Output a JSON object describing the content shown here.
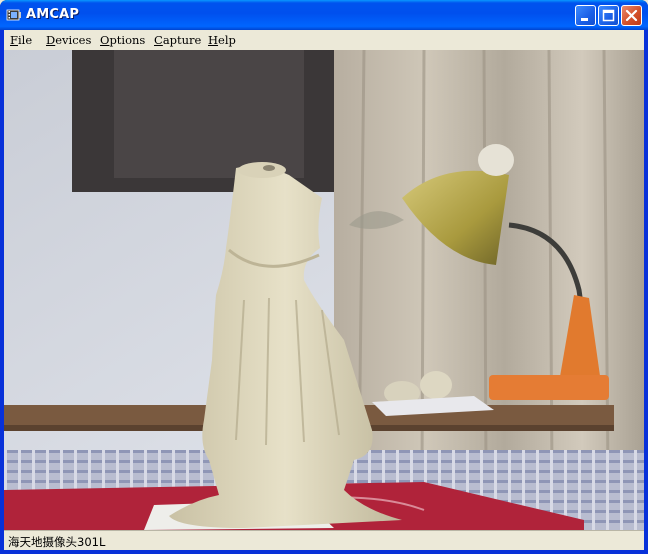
{
  "window": {
    "title": "AMCAP"
  },
  "menu": {
    "items": [
      {
        "label": "File"
      },
      {
        "label": "Devices"
      },
      {
        "label": "Options"
      },
      {
        "label": "Capture"
      },
      {
        "label": "Help"
      }
    ]
  },
  "status": {
    "text": "海天地摄像头301L"
  },
  "icons": {
    "app": "film-camera-icon",
    "minimize": "minimize-icon",
    "maximize": "maximize-icon",
    "close": "close-icon"
  },
  "colors": {
    "title_bar": "#0053ee",
    "close_button": "#d4512a",
    "chrome": "#ece9d8"
  }
}
